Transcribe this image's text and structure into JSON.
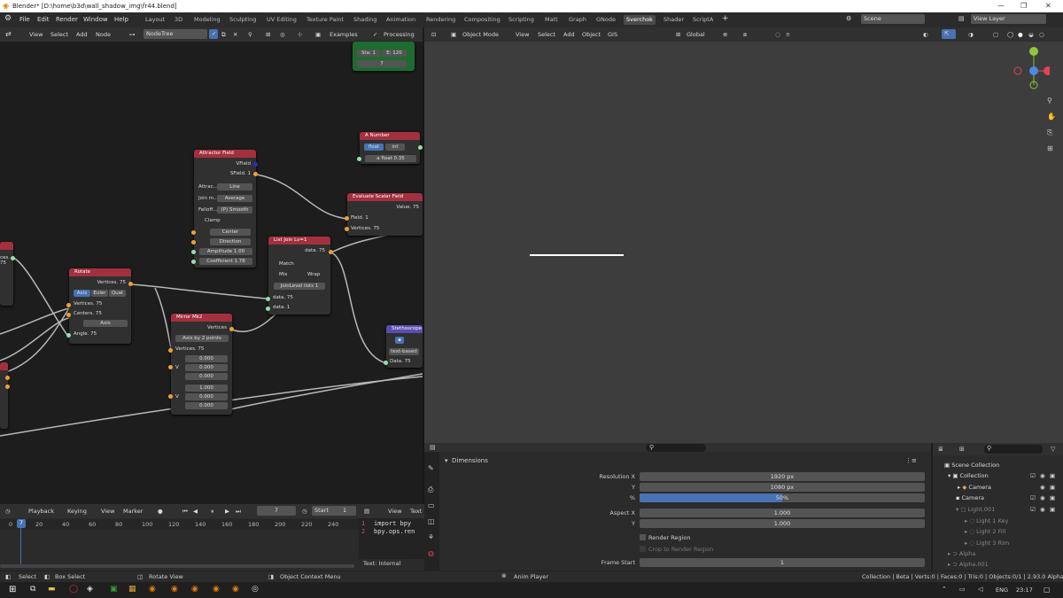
{
  "window": {
    "title": "Blender* [D:\\home\\b3d\\wall_shadow_img\\fr44.blend]"
  },
  "menu": [
    "File",
    "Edit",
    "Render",
    "Window",
    "Help"
  ],
  "workspaces": [
    "Layout",
    "3D",
    "Modeling",
    "Sculpting",
    "UV Editing",
    "Texture Paint",
    "Shading",
    "Animation",
    "Rendering",
    "Compositing",
    "Scripting",
    "Matt",
    "Graph",
    "GNode",
    "Sverchok",
    "Shader",
    "ScriptA"
  ],
  "active_workspace": "Sverchok",
  "scene": "Scene",
  "view_layer": "View Layer",
  "node_header": {
    "view": "View",
    "select": "Select",
    "add": "Add",
    "node": "Node",
    "tree": "NodeTree",
    "examples": "Examples",
    "processing": "Processing"
  },
  "viewport_header": {
    "mode": "Object Mode",
    "view": "View",
    "select": "Select",
    "add": "Add",
    "object": "Object",
    "gis": "GIS",
    "orientation": "Global"
  },
  "nodes": {
    "frame": {
      "sta": "Sta: 1",
      "end": "E: 120",
      "cur": "7"
    },
    "a_number": {
      "title": "A Number",
      "float": "float",
      "int": "int",
      "field": "a float",
      "value": "0.35"
    },
    "attractor": {
      "title": "Attractor Field",
      "vfield": "VField",
      "sfield": "SField. 1",
      "attract_l": "Attrac...",
      "attract_v": "Line",
      "join_l": "Join m...",
      "join_v": "Average",
      "falloff_l": "Falloff...",
      "falloff_v": "(P) Smooth",
      "clamp": "Clamp",
      "center": "Center",
      "direction": "Direction",
      "amplitude": "Amplitude",
      "amplitude_v": "1.00",
      "coefficient": "Coefficient",
      "coefficient_v": "1.78"
    },
    "evaluate": {
      "title": "Evaluate Scalar Field",
      "value": "Value. 75",
      "field": "Field. 1",
      "vertices": "Vertices. 75"
    },
    "listjoin": {
      "title": "List Join Lv=1",
      "data": "data. 75",
      "match": "Match",
      "mix": "Mix",
      "wrap": "Wrap",
      "level": "JoinLevel lists",
      "level_v": "1",
      "in1": "data. 75",
      "in2": "data. 1"
    },
    "rotate": {
      "title": "Rotate",
      "verts_out": "Vertices. 75",
      "axis": "Axis",
      "euler": "Euler",
      "quat": "Quat",
      "vertices": "Vertices. 75",
      "centers": "Centers. 75",
      "axis_sel": "Axis",
      "angle": "Angle. 75"
    },
    "mirror": {
      "title": "Mirror Mk2",
      "verts_out": "Vertices",
      "mode": "Axis by 2 points",
      "vertices": "Vertices. 75",
      "v1": "0.000",
      "v2": "0.000",
      "v3": "0.000",
      "v4": "1.000",
      "v5": "0.000",
      "v6": "0.000",
      "vlabel": "V"
    },
    "stetho": {
      "title": "Stethoscope",
      "mode": "text-based",
      "data": "Data. 75"
    },
    "left1": {
      "label": "ces. 75"
    }
  },
  "timeline": {
    "playback": "Playback",
    "keying": "Keying",
    "view": "View",
    "marker": "Marker",
    "current": "7",
    "start_label": "Start",
    "start": "1",
    "ticks": [
      "0",
      "20",
      "40",
      "60",
      "80",
      "100",
      "120",
      "140",
      "160",
      "180",
      "200",
      "220",
      "240"
    ]
  },
  "text_editor": {
    "view": "View",
    "text": "Text",
    "line1": "import bpy",
    "line2": "bpy.ops.ren",
    "footer": "Text: Internal"
  },
  "properties": {
    "section": "Dimensions",
    "res_x_label": "Resolution X",
    "res_x": "1920 px",
    "res_y_label": "Y",
    "res_y": "1080 px",
    "pct_label": "%",
    "pct": "50%",
    "pct_fill": 0.5,
    "aspect_x_label": "Aspect X",
    "aspect_x": "1.000",
    "aspect_y_label": "Y",
    "aspect_y": "1.000",
    "render_region": "Render Region",
    "crop": "Crop to Render Region",
    "frame_start_label": "Frame Start",
    "frame_start": "1"
  },
  "outliner": [
    "Scene Collection",
    "Collection",
    "Camera",
    "Camera",
    "Light.001",
    "Light 1 Key",
    "Light 2 Fill",
    "Light 3 Rim",
    "Alpha",
    "Alpha.001"
  ],
  "status": {
    "select": "Select",
    "box": "Box Select",
    "rotate": "Rotate View",
    "context": "Object Context Menu",
    "anim": "Anim Player",
    "info": "Collection | Beta | Verts:0 | Faces:0 | Tris:0 | Objects:0/1 | 2.93.0 Alpha"
  },
  "taskbar": {
    "lang": "ENG",
    "time": "23:17"
  },
  "colors": {
    "node_header": "#a3303e",
    "accent": "#4772b3",
    "viewport": "#3d3d3d"
  }
}
